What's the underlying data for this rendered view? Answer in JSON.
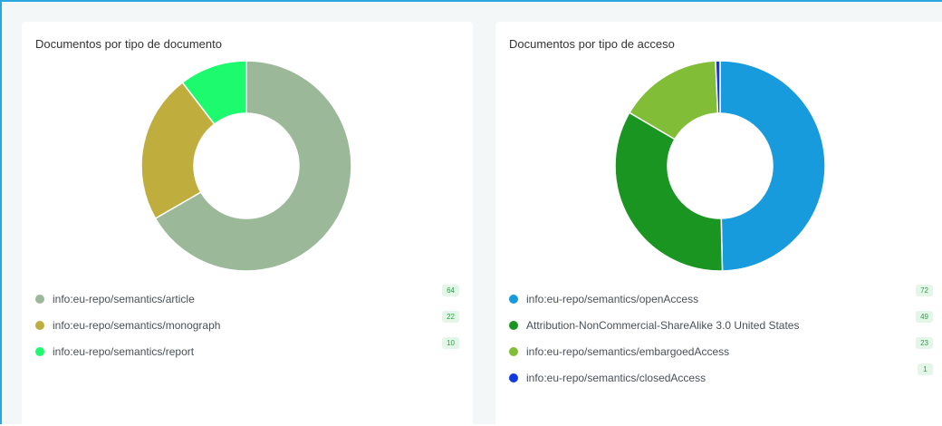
{
  "charts": [
    {
      "id": "left",
      "title": "Documentos por tipo de documento",
      "legend_rows": [
        {
          "label": "info:eu-repo/semantics/article",
          "value": "64"
        },
        {
          "label": "info:eu-repo/semantics/monograph",
          "value": "22"
        },
        {
          "label": "info:eu-repo/semantics/report",
          "value": "10"
        }
      ]
    },
    {
      "id": "right",
      "title": "Documentos por tipo de acceso",
      "legend_rows": [
        {
          "label": "info:eu-repo/semantics/openAccess",
          "value": "72"
        },
        {
          "label": "Attribution-NonCommercial-ShareAlike 3.0 United States",
          "value": "49"
        },
        {
          "label": "info:eu-repo/semantics/embargoedAccess",
          "value": "23"
        },
        {
          "label": "info:eu-repo/semantics/closedAccess",
          "value": "1"
        }
      ]
    }
  ],
  "chart_data": [
    {
      "type": "pie",
      "title": "Documentos por tipo de documento",
      "categories": [
        "info:eu-repo/semantics/article",
        "info:eu-repo/semantics/monograph",
        "info:eu-repo/semantics/report"
      ],
      "values": [
        64,
        22,
        10
      ],
      "colors": [
        "#9bb899",
        "#bfad3e",
        "#1efa6e"
      ],
      "donut": true,
      "legend_placement": "bottom"
    },
    {
      "type": "pie",
      "title": "Documentos por tipo de acceso",
      "categories": [
        "info:eu-repo/semantics/openAccess",
        "Attribution-NonCommercial-ShareAlike 3.0 United States",
        "info:eu-repo/semantics/embargoedAccess",
        "info:eu-repo/semantics/closedAccess"
      ],
      "values": [
        72,
        49,
        23,
        1
      ],
      "colors": [
        "#179bdd",
        "#1b9521",
        "#82bd37",
        "#1039e0"
      ],
      "donut": true,
      "legend_placement": "bottom"
    }
  ]
}
